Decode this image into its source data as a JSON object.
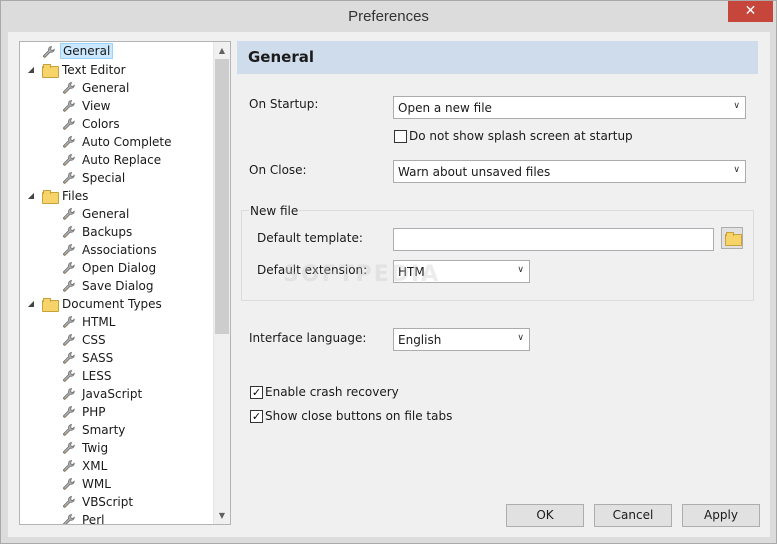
{
  "window": {
    "title": "Preferences",
    "close_glyph": "✕"
  },
  "tree": {
    "items": [
      {
        "label": "General",
        "icon": "wrench-icon",
        "selected": true
      },
      {
        "label": "Text Editor",
        "icon": "folder-icon"
      },
      {
        "label": "General",
        "icon": "wrench-icon"
      },
      {
        "label": "View",
        "icon": "wrench-icon"
      },
      {
        "label": "Colors",
        "icon": "wrench-icon"
      },
      {
        "label": "Auto Complete",
        "icon": "wrench-icon"
      },
      {
        "label": "Auto Replace",
        "icon": "wrench-icon"
      },
      {
        "label": "Special",
        "icon": "wrench-icon"
      },
      {
        "label": "Files",
        "icon": "folder-icon"
      },
      {
        "label": "General",
        "icon": "wrench-icon"
      },
      {
        "label": "Backups",
        "icon": "wrench-icon"
      },
      {
        "label": "Associations",
        "icon": "wrench-icon"
      },
      {
        "label": "Open Dialog",
        "icon": "wrench-icon"
      },
      {
        "label": "Save Dialog",
        "icon": "wrench-icon"
      },
      {
        "label": "Document Types",
        "icon": "folder-icon"
      },
      {
        "label": "HTML",
        "icon": "wrench-icon"
      },
      {
        "label": "CSS",
        "icon": "wrench-icon"
      },
      {
        "label": "SASS",
        "icon": "wrench-icon"
      },
      {
        "label": "LESS",
        "icon": "wrench-icon"
      },
      {
        "label": "JavaScript",
        "icon": "wrench-icon"
      },
      {
        "label": "PHP",
        "icon": "wrench-icon"
      },
      {
        "label": "Smarty",
        "icon": "wrench-icon"
      },
      {
        "label": "Twig",
        "icon": "wrench-icon"
      },
      {
        "label": "XML",
        "icon": "wrench-icon"
      },
      {
        "label": "WML",
        "icon": "wrench-icon"
      },
      {
        "label": "VBScript",
        "icon": "wrench-icon"
      },
      {
        "label": "Perl",
        "icon": "wrench-icon"
      }
    ],
    "expander_glyph": "◢",
    "scroll_up_glyph": "▲",
    "scroll_down_glyph": "▼"
  },
  "panel": {
    "title": "General",
    "on_startup_label": "On Startup:",
    "on_startup_value": "Open a new file",
    "splash_label": "Do not show splash screen at startup",
    "splash_checked": false,
    "on_close_label": "On Close:",
    "on_close_value": "Warn about unsaved files",
    "new_file_group": "New file",
    "default_template_label": "Default template:",
    "default_template_value": "",
    "default_extension_label": "Default extension:",
    "default_extension_value": "HTM",
    "interface_language_label": "Interface language:",
    "interface_language_value": "English",
    "crash_recovery_label": "Enable crash recovery",
    "crash_recovery_checked": true,
    "close_buttons_label": "Show close buttons on file tabs",
    "close_buttons_checked": true,
    "dropdown_glyph": "∨",
    "check_glyph": "✓"
  },
  "buttons": {
    "ok": "OK",
    "cancel": "Cancel",
    "apply": "Apply"
  },
  "watermark": "SOFTPEDIA",
  "colors": {
    "header_bg": "#cfdcec",
    "selection_bg": "#cce8ff",
    "close_btn": "#c7463b"
  }
}
